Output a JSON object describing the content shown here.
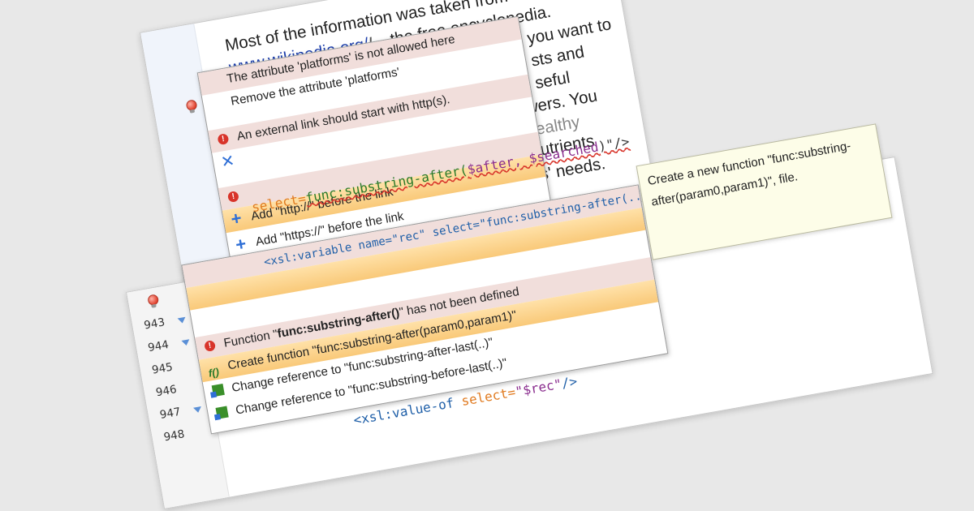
{
  "top_editor": {
    "doc_lines": [
      "Most of the information was taken from",
      "the free encyclopedia.",
      "you want to",
      "sts and",
      "seful",
      "flowers. You",
      "gardening, landscaping and healthy",
      "have to balance the soil structure with nutrients",
      "and regulate the pH to cover your plants' needs."
    ],
    "link_text": "www.wikipedia.org/",
    "quickfix": [
      {
        "kind": "problem",
        "label": "The attribute 'platforms' is not allowed here"
      },
      {
        "kind": "fix",
        "icon": "remove-icon",
        "label": "Remove the attribute 'platforms'"
      },
      {
        "kind": "problem",
        "label": "An external link should start with http(s)."
      },
      {
        "kind": "fix-selected",
        "icon": "add-icon",
        "label": "Add \"http://\" before the link"
      },
      {
        "kind": "fix",
        "icon": "add-icon",
        "label": "Add \"https://\" before the link"
      }
    ]
  },
  "bottom_editor": {
    "line_numbers": [
      "943",
      "944",
      "945",
      "946",
      "947",
      "948"
    ],
    "code_line1": {
      "attr": "select=",
      "value_fn": "func:substring-after(",
      "value_args": "$after, $searched",
      "close": ")\"/>"
    },
    "code_line2": {
      "tag": "<xsl:variable",
      "attr1": "name=",
      "val1": "\"rec\"",
      "attr2": "select=",
      "val2": "\"func:substring-after(..."
    },
    "code_line3": {
      "tag": "<xsl:value-of",
      "attr": "select=",
      "val": "\"$rec\"",
      "close": "/>"
    },
    "quickfix": {
      "problem_prefix": "Function \"",
      "problem_name": "func:substring-after()",
      "problem_suffix": "\" has not been defined",
      "items": [
        "Create function \"func:substring-after(param0,param1)\"",
        "Change reference to \"func:substring-after-last(..)\"",
        "Change reference to \"func:substring-before-last(..)\""
      ]
    },
    "tooltip": "Create a new function \"func:substring-after(param0,param1)\", file."
  }
}
